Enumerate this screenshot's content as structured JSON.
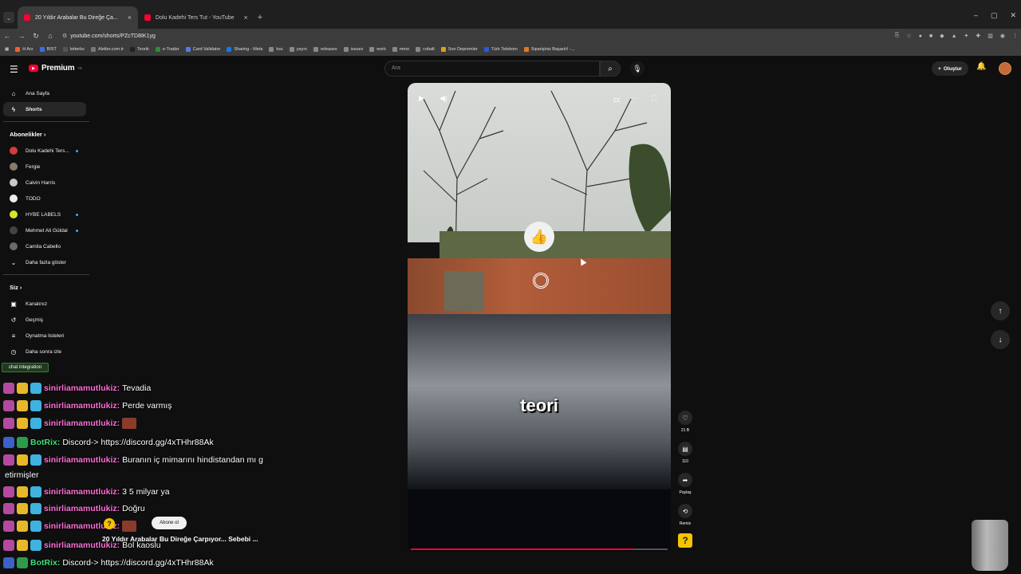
{
  "browser": {
    "tabs": [
      {
        "title": "20 Yıldır Arabalar Bu Direğe Ça..."
      },
      {
        "title": "Dolu Kadehi Ters Tut - YouTube"
      }
    ],
    "url": "youtube.com/shorts/PZcTD8IK1yg",
    "bookmarks": [
      "H Arz",
      "BIST",
      "letterbx",
      "Aletler.com.tr",
      "Teorik",
      "e-Trader",
      "Card Validator",
      "Sharing - Meta",
      "kss",
      "yayın",
      "releases",
      "issues",
      "work",
      "mmo",
      "cobalt",
      "Son Depremler",
      "Türk Telekom",
      "Siparişiniz Başarılı! -..."
    ]
  },
  "header": {
    "logo": "Premium",
    "logo_sup": "TR",
    "search_placeholder": "Ara",
    "create_label": "Oluştur"
  },
  "sidebar": {
    "main": [
      {
        "label": "Ana Sayfa"
      },
      {
        "label": "Shorts"
      }
    ],
    "subs_heading": "Abonelikler",
    "subs": [
      {
        "label": "Dolu Kadehi Ters...",
        "color": "#d23c3c"
      },
      {
        "label": "Fergie",
        "color": "#8a7a6a"
      },
      {
        "label": "Calvin Harris",
        "color": "#c8c8c8"
      },
      {
        "label": "TODO",
        "color": "#eeeeee"
      },
      {
        "label": "HYBE LABELS",
        "color": "#d8e62a"
      },
      {
        "label": "Mehmet Ali Güldal",
        "color": "#444444"
      },
      {
        "label": "Camila Cabello",
        "color": "#6a6a6a"
      },
      {
        "label": "Daha fazla göster",
        "color": ""
      }
    ],
    "you_heading": "Siz",
    "you": [
      {
        "label": "Kanalınız"
      },
      {
        "label": "Geçmiş"
      },
      {
        "label": "Oynatma listeleri"
      },
      {
        "label": "Daha sonra izle"
      }
    ]
  },
  "chat": {
    "integration_label": "chat integration",
    "messages": [
      {
        "user": "sinirliamamutlukiz:",
        "text": "Tevadia",
        "bot": false
      },
      {
        "user": "sinirliamamutlukiz:",
        "text": "Perde varmış",
        "bot": false
      },
      {
        "user": "sinirliamamutlukiz:",
        "text": "",
        "bot": false
      },
      {
        "user": "BotRix:",
        "text": "Discord-> https://discord.gg/4xTHhr88Ak",
        "bot": true
      },
      {
        "user": "sinirliamamutlukiz:",
        "text": "Buranın iç mimarını hindistandan mı g",
        "bot": false
      },
      {
        "user": "sinirliamamutlukiz:",
        "text": "3 5 milyar ya",
        "bot": false
      },
      {
        "user": "sinirliamamutlukiz:",
        "text": "Doğru",
        "bot": false
      },
      {
        "user": "sinirliamamutlukiz:",
        "text": "",
        "bot": false
      },
      {
        "user": "sinirliamamutlukiz:",
        "text": "Bol kaoslu",
        "bot": false
      },
      {
        "user": "BotRix:",
        "text": "Discord-> https://discord.gg/4xTHhr88Ak",
        "bot": true
      }
    ],
    "continuation": "etirmişler"
  },
  "shorts": {
    "caption": "teori",
    "title_below": "20 Yıldır Arabalar Bu Direğe Çarpıyor... Sebebi ...",
    "subscribe_label": "Abone ol",
    "likes": "21 B",
    "comments": "110",
    "share_label": "Paylaş",
    "remix_label": "Remix",
    "progress_percent": 87
  }
}
